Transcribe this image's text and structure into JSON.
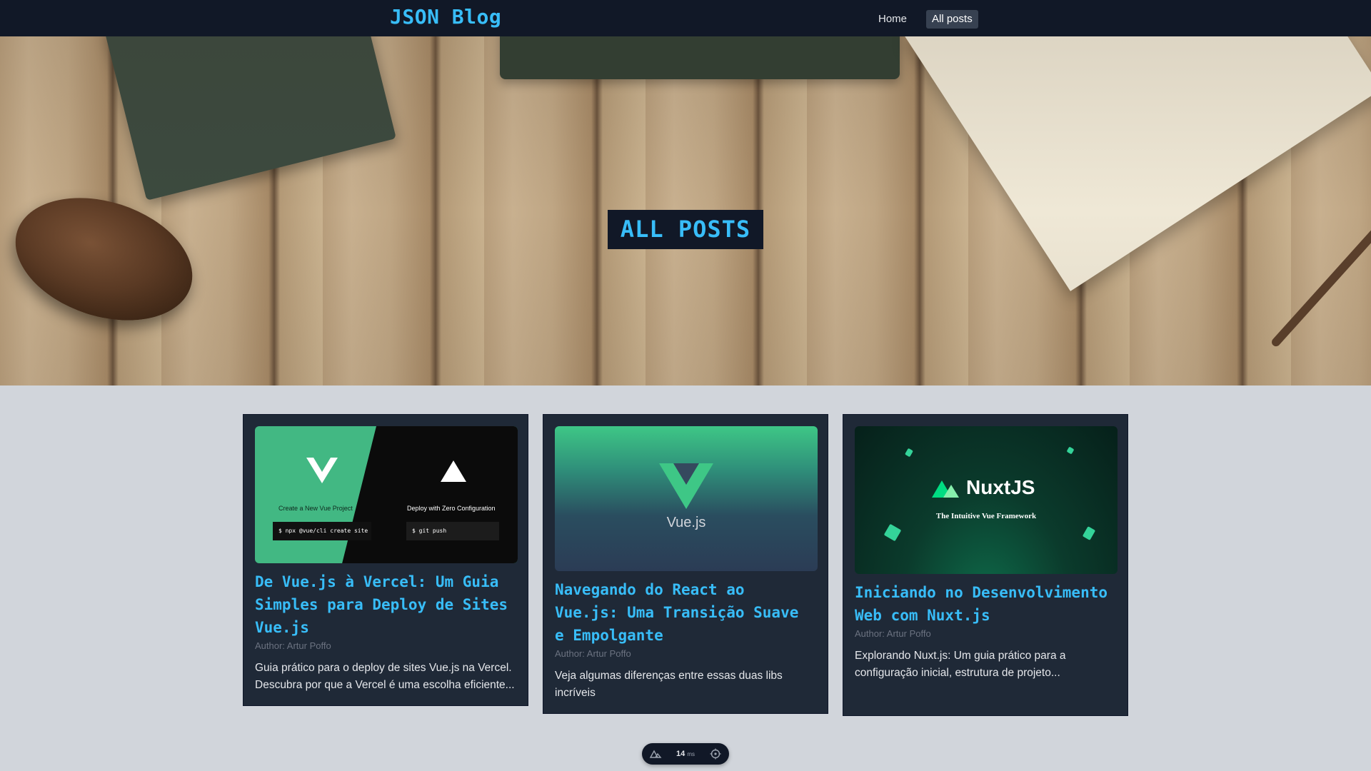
{
  "nav": {
    "brand": "JSON Blog",
    "links": [
      {
        "label": "Home",
        "active": false
      },
      {
        "label": "All posts",
        "active": true
      }
    ]
  },
  "hero": {
    "title": "ALL POSTS"
  },
  "posts": [
    {
      "title": "De Vue.js à Vercel: Um Guia Simples para Deploy de Sites Vue.js",
      "author": "Author: Artur Poffo",
      "description": "Guia prático para o deploy de sites Vue.js na Vercel. Descubra por que a Vercel é uma escolha eficiente...",
      "image": {
        "left_label": "Create a New Vue Project",
        "left_command": "$ npx @vue/cli create site",
        "right_label": "Deploy with Zero Configuration",
        "right_command": "$ git push"
      }
    },
    {
      "title": "Navegando do React ao Vue.js: Uma Transição Suave e Empolgante",
      "author": "Author: Artur Poffo",
      "description": "Veja algumas diferenças entre essas duas libs incríveis",
      "image": {
        "wordmark": "Vue.js"
      }
    },
    {
      "title": "Iniciando no Desenvolvimento Web com Nuxt.js",
      "author": "Author: Artur Poffo",
      "description": "Explorando Nuxt.js: Um guia prático para a configuração inicial, estrutura de projeto...",
      "image": {
        "wordmark": "NuxtJS",
        "tagline": "The Intuitive Vue Framework"
      }
    }
  ],
  "devbar": {
    "value": "14",
    "unit": "ms"
  },
  "colors": {
    "accent": "#38bdf8",
    "nav_bg": "#111827",
    "card_bg": "#1f2937",
    "page_bg": "#d1d5db"
  }
}
